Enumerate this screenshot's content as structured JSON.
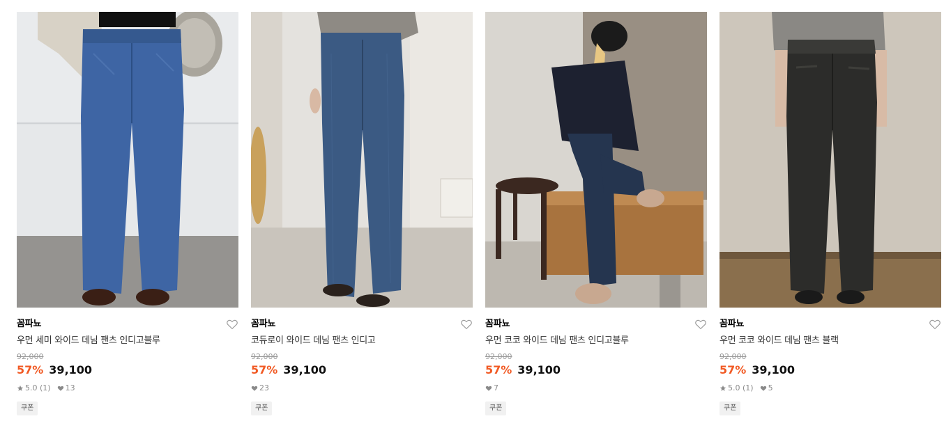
{
  "products": [
    {
      "brand": "꼼파뇨",
      "title": "우먼 세미 와이드 데님 팬츠 인디고블루",
      "original_price": "92,000",
      "discount": "57%",
      "price": "39,100",
      "rating": "5.0 (1)",
      "likes": "13",
      "badge": "쿠폰",
      "image": "model in blue semi-wide denim jeans with brown loafers"
    },
    {
      "brand": "꼼파뇨",
      "title": "코듀로이 와이드 데님 팬츠 인디고",
      "original_price": "92,000",
      "discount": "57%",
      "price": "39,100",
      "rating": "",
      "likes": "23",
      "badge": "쿠폰",
      "image": "model in indigo corduroy wide denim with black sandals"
    },
    {
      "brand": "꼼파뇨",
      "title": "우먼 코코 와이드 데님 팬츠 인디고블루",
      "original_price": "92,000",
      "discount": "57%",
      "price": "39,100",
      "rating": "",
      "likes": "7",
      "badge": "쿠폰",
      "image": "model in black cap and navy hoodie wearing indigo wide jeans by wooden bench"
    },
    {
      "brand": "꼼파뇨",
      "title": "우먼 코코 와이드 데님 팬츠 블랙",
      "original_price": "92,000",
      "discount": "57%",
      "price": "39,100",
      "rating": "5.0 (1)",
      "likes": "5",
      "badge": "쿠폰",
      "image": "model in washed black wide denim with gray cardigan"
    }
  ],
  "colors": {
    "discount": "#f15a24",
    "price": "#111111",
    "meta": "#8a8a8a",
    "badge_bg": "#f1f1f1"
  },
  "icons": [
    "heart-outline-icon",
    "star-icon",
    "heart-filled-icon"
  ]
}
